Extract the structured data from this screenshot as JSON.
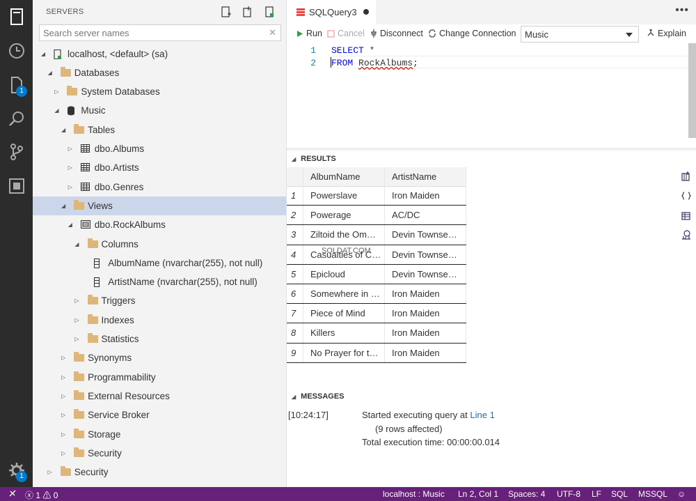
{
  "activity_bar": {
    "items": [
      {
        "icon": "servers-icon"
      },
      {
        "icon": "history-icon"
      },
      {
        "icon": "file-icon",
        "badge": "1"
      },
      {
        "icon": "search-icon"
      },
      {
        "icon": "source-control-icon"
      },
      {
        "icon": "extensions-icon"
      }
    ],
    "settings_badge": "1"
  },
  "sidebar": {
    "title": "SERVERS",
    "search_placeholder": "Search server names",
    "tree": [
      {
        "label": "localhost, <default> (sa)",
        "depth": 0,
        "icon": "server",
        "expanded": true
      },
      {
        "label": "Databases",
        "depth": 1,
        "icon": "folder",
        "expanded": true
      },
      {
        "label": "System Databases",
        "depth": 2,
        "icon": "folder",
        "expanded": false
      },
      {
        "label": "Music",
        "depth": 2,
        "icon": "database",
        "expanded": true
      },
      {
        "label": "Tables",
        "depth": 3,
        "icon": "folder",
        "expanded": true
      },
      {
        "label": "dbo.Albums",
        "depth": 4,
        "icon": "table",
        "expanded": false
      },
      {
        "label": "dbo.Artists",
        "depth": 4,
        "icon": "table",
        "expanded": false
      },
      {
        "label": "dbo.Genres",
        "depth": 4,
        "icon": "table",
        "expanded": false
      },
      {
        "label": "Views",
        "depth": 3,
        "icon": "folder",
        "expanded": true,
        "selected": true
      },
      {
        "label": "dbo.RockAlbums",
        "depth": 4,
        "icon": "view",
        "expanded": true
      },
      {
        "label": "Columns",
        "depth": 5,
        "icon": "folder",
        "expanded": true
      },
      {
        "label": "AlbumName (nvarchar(255), not null)",
        "depth": 6,
        "icon": "column",
        "leaf": true
      },
      {
        "label": "ArtistName (nvarchar(255), not null)",
        "depth": 6,
        "icon": "column",
        "leaf": true
      },
      {
        "label": "Triggers",
        "depth": 5,
        "icon": "folder",
        "expanded": false
      },
      {
        "label": "Indexes",
        "depth": 5,
        "icon": "folder",
        "expanded": false
      },
      {
        "label": "Statistics",
        "depth": 5,
        "icon": "folder",
        "expanded": false
      },
      {
        "label": "Synonyms",
        "depth": 3,
        "icon": "folder",
        "expanded": false
      },
      {
        "label": "Programmability",
        "depth": 3,
        "icon": "folder",
        "expanded": false
      },
      {
        "label": "External Resources",
        "depth": 3,
        "icon": "folder",
        "expanded": false
      },
      {
        "label": "Service Broker",
        "depth": 3,
        "icon": "folder",
        "expanded": false
      },
      {
        "label": "Storage",
        "depth": 3,
        "icon": "folder",
        "expanded": false
      },
      {
        "label": "Security",
        "depth": 3,
        "icon": "folder",
        "expanded": false
      },
      {
        "label": "Security",
        "depth": 1,
        "icon": "folder",
        "expanded": false
      }
    ]
  },
  "editor": {
    "tab_label": "SQLQuery3",
    "toolbar": {
      "run": "Run",
      "cancel": "Cancel",
      "disconnect": "Disconnect",
      "change_connection": "Change Connection",
      "database": "Music",
      "explain": "Explain"
    },
    "code_lines": [
      {
        "num": "1",
        "kw": "SELECT",
        "rest": " *",
        "squiggle": ""
      },
      {
        "num": "2",
        "kw": "FROM",
        "rest": " ",
        "squiggle": "RockAlbums",
        "tail": ";"
      }
    ]
  },
  "results": {
    "header": "RESULTS",
    "columns": [
      "AlbumName",
      "ArtistName"
    ],
    "rows": [
      [
        "1",
        "Powerslave",
        "Iron Maiden"
      ],
      [
        "2",
        "Powerage",
        "AC/DC"
      ],
      [
        "3",
        "Ziltoid the Om…",
        "Devin Townse…"
      ],
      [
        "4",
        "Casualties of C…",
        "Devin Townse…"
      ],
      [
        "5",
        "Epicloud",
        "Devin Townse…"
      ],
      [
        "6",
        "Somewhere in …",
        "Iron Maiden"
      ],
      [
        "7",
        "Piece of Mind",
        "Iron Maiden"
      ],
      [
        "8",
        "Killers",
        "Iron Maiden"
      ],
      [
        "9",
        "No Prayer for t…",
        "Iron Maiden"
      ]
    ],
    "watermark": "SQLDAT.COM"
  },
  "messages": {
    "header": "MESSAGES",
    "timestamp": "[10:24:17]",
    "line1_prefix": "Started executing query at ",
    "line1_link": "Line 1",
    "line2": "(9 rows affected)",
    "line3": "Total execution time: 00:00:00.014"
  },
  "status_bar": {
    "errors": "1",
    "warnings": "0",
    "connection": "localhost : Music",
    "position": "Ln 2, Col 1",
    "spaces": "Spaces: 4",
    "encoding": "UTF-8",
    "eol": "LF",
    "language": "SQL",
    "provider": "MSSQL",
    "colors": {
      "background": "#68217a"
    }
  }
}
